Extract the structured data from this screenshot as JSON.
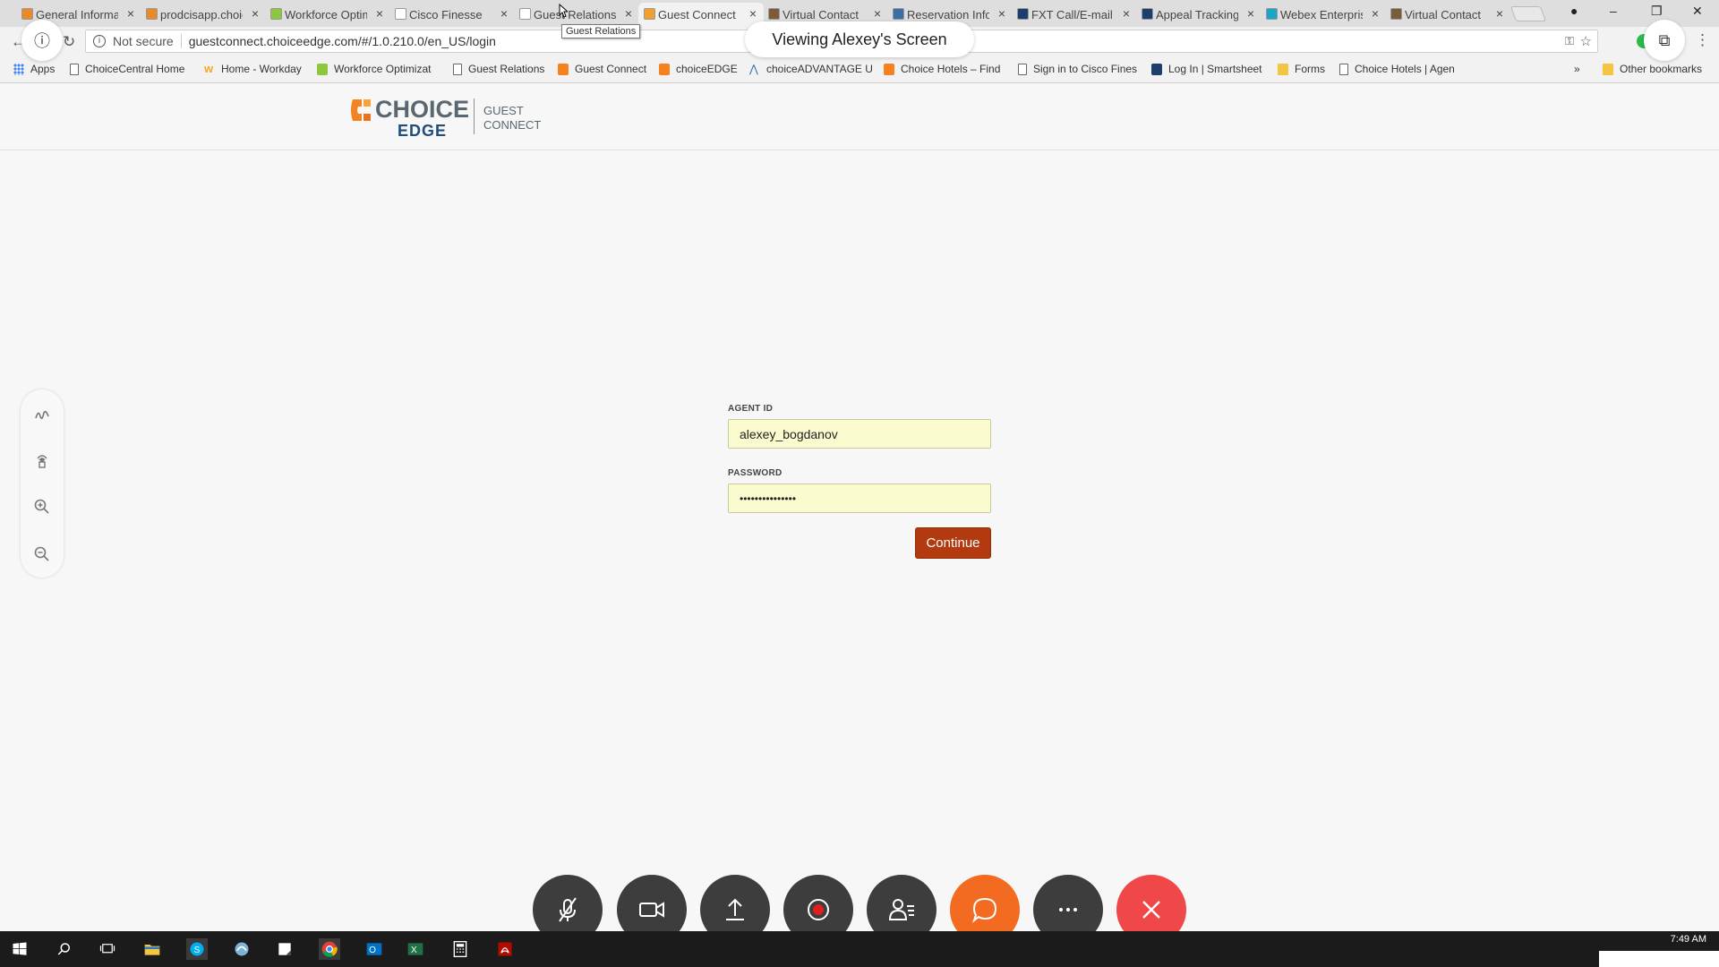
{
  "browser": {
    "tabs": [
      {
        "title": "General Information",
        "favicon": "#e8892b"
      },
      {
        "title": "prodcisapp.choice",
        "favicon": "#e8892b"
      },
      {
        "title": "Workforce Optimization",
        "favicon": "#8dc63f"
      },
      {
        "title": "Cisco Finesse",
        "favicon": "#ffffff"
      },
      {
        "title": "Guest Relations",
        "favicon": "#ffffff"
      },
      {
        "title": "Guest Connect",
        "favicon": "#f0a030"
      },
      {
        "title": "Virtual Contact",
        "favicon": "#7a5c3a"
      },
      {
        "title": "Reservation Info",
        "favicon": "#3a6ea5"
      },
      {
        "title": "FXT Call/E-mail",
        "favicon": "#1c3f6e"
      },
      {
        "title": "Appeal Tracking",
        "favicon": "#1c3f6e"
      },
      {
        "title": "Webex Enterprise",
        "favicon": "#1ba6c8"
      },
      {
        "title": "Virtual Contact",
        "favicon": "#7a5c3a"
      }
    ],
    "active_tab_index": 5,
    "tooltip": "Guest Relations",
    "security": "Not secure",
    "url": "guestconnect.choiceedge.com/#/1.0.210.0/en_US/login"
  },
  "bookmarks": [
    {
      "label": "Apps",
      "icon": "apps-grid-icon"
    },
    {
      "label": "ChoiceCentral Home",
      "icon": "page-icon"
    },
    {
      "label": "Home - Workday",
      "icon": "workday-icon"
    },
    {
      "label": "Workforce Optimizat",
      "icon": "wfo-icon"
    },
    {
      "label": "Guest Relations",
      "icon": "page-icon"
    },
    {
      "label": "Guest Connect",
      "icon": "choice-icon"
    },
    {
      "label": "choiceEDGE",
      "icon": "choice-icon"
    },
    {
      "label": "choiceADVANTAGE U",
      "icon": "advantage-icon"
    },
    {
      "label": "Choice Hotels – Find",
      "icon": "choice-icon"
    },
    {
      "label": "Sign in to Cisco Fines",
      "icon": "page-icon"
    },
    {
      "label": "Log In | Smartsheet",
      "icon": "smartsheet-icon"
    },
    {
      "label": "Forms",
      "icon": "folder-icon"
    },
    {
      "label": "Choice Hotels | Agen",
      "icon": "page-icon"
    }
  ],
  "bookmarks_overflow": "»",
  "other_bookmarks": "Other bookmarks",
  "webex": {
    "viewing_label": "Viewing Alexey's Screen"
  },
  "page": {
    "logo": {
      "line1": "CHOICE",
      "line2": "EDGE",
      "product_line1": "GUEST",
      "product_line2": "CONNECT"
    },
    "form": {
      "agent_id_label": "AGENT ID",
      "agent_id_value": "alexey_bogdanov",
      "password_label": "PASSWORD",
      "password_value": "•••••••••••••••",
      "submit_label": "Continue"
    }
  },
  "taskbar": {
    "clock": "7:49 AM"
  },
  "colors": {
    "accent_button": "#b23a0e",
    "autofill_yellow": "#fafcd0",
    "end_call_red": "#f04848",
    "chat_orange": "#f26b21",
    "logo_navy": "#1d4f7a"
  }
}
